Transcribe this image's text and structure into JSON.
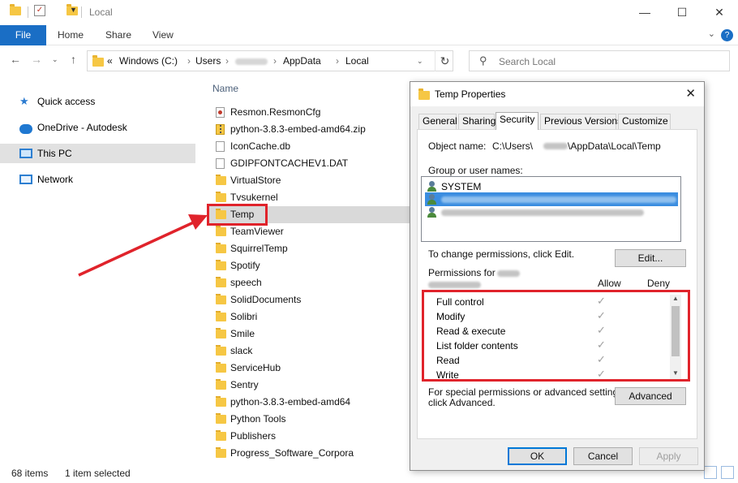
{
  "titlebar": {
    "title": "Local"
  },
  "ribbon": {
    "tabs": [
      "File",
      "Home",
      "Share",
      "View"
    ]
  },
  "address": {
    "crumbs": [
      "Windows (C:)",
      "Users",
      "AppData",
      "Local"
    ],
    "prefix": "«",
    "search_placeholder": "Search Local"
  },
  "navpane": {
    "items": [
      {
        "label": "Quick access",
        "icon": "star-icon"
      },
      {
        "label": "OneDrive - Autodesk",
        "icon": "cloud-icon"
      },
      {
        "label": "This PC",
        "icon": "pc-icon",
        "selected": true
      },
      {
        "label": "Network",
        "icon": "network-icon"
      }
    ]
  },
  "filelist": {
    "header": "Name",
    "items": [
      {
        "name": "Resmon.ResmonCfg",
        "type": "cfg"
      },
      {
        "name": "python-3.8.3-embed-amd64.zip",
        "type": "zip"
      },
      {
        "name": "IconCache.db",
        "type": "doc"
      },
      {
        "name": "GDIPFONTCACHEV1.DAT",
        "type": "doc"
      },
      {
        "name": "VirtualStore",
        "type": "folder"
      },
      {
        "name": "Tvsukernel",
        "type": "folder"
      },
      {
        "name": "Temp",
        "type": "folder",
        "selected": true
      },
      {
        "name": "TeamViewer",
        "type": "folder"
      },
      {
        "name": "SquirrelTemp",
        "type": "folder"
      },
      {
        "name": "Spotify",
        "type": "folder"
      },
      {
        "name": "speech",
        "type": "folder"
      },
      {
        "name": "SolidDocuments",
        "type": "folder"
      },
      {
        "name": "Solibri",
        "type": "folder"
      },
      {
        "name": "Smile",
        "type": "folder"
      },
      {
        "name": "slack",
        "type": "folder"
      },
      {
        "name": "ServiceHub",
        "type": "folder"
      },
      {
        "name": "Sentry",
        "type": "folder"
      },
      {
        "name": "python-3.8.3-embed-amd64",
        "type": "folder"
      },
      {
        "name": "Python Tools",
        "type": "folder"
      },
      {
        "name": "Publishers",
        "type": "folder"
      },
      {
        "name": "Progress_Software_Corpora",
        "type": "folder"
      }
    ]
  },
  "status": {
    "count": "68 items",
    "selected": "1 item selected"
  },
  "dialog": {
    "title": "Temp Properties",
    "close": "✕",
    "tabs": [
      "General",
      "Sharing",
      "Security",
      "Previous Versions",
      "Customize"
    ],
    "active_tab": "Security",
    "object_label": "Object name:",
    "object_path_a": "C:\\Users\\",
    "object_path_b": "\\AppData\\Local\\Temp",
    "group_label": "Group or user names:",
    "users": [
      {
        "name": "SYSTEM"
      },
      {
        "name": "",
        "selected": true
      },
      {
        "name": ""
      }
    ],
    "change_hint": "To change permissions, click Edit.",
    "edit_button": "Edit...",
    "perm_label": "Permissions for",
    "allow": "Allow",
    "deny": "Deny",
    "permissions": [
      {
        "name": "Full control",
        "allow": "✓"
      },
      {
        "name": "Modify",
        "allow": "✓"
      },
      {
        "name": "Read & execute",
        "allow": "✓"
      },
      {
        "name": "List folder contents",
        "allow": "✓"
      },
      {
        "name": "Read",
        "allow": "✓"
      },
      {
        "name": "Write",
        "allow": "✓"
      }
    ],
    "special_hint_1": "For special permissions or advanced settings,",
    "special_hint_2": "click Advanced.",
    "advanced_button": "Advanced",
    "ok": "OK",
    "cancel": "Cancel",
    "apply": "Apply"
  },
  "colors": {
    "accent": "#1a6ec5",
    "annotation": "#e0232b",
    "selection": "#3a8de0"
  }
}
